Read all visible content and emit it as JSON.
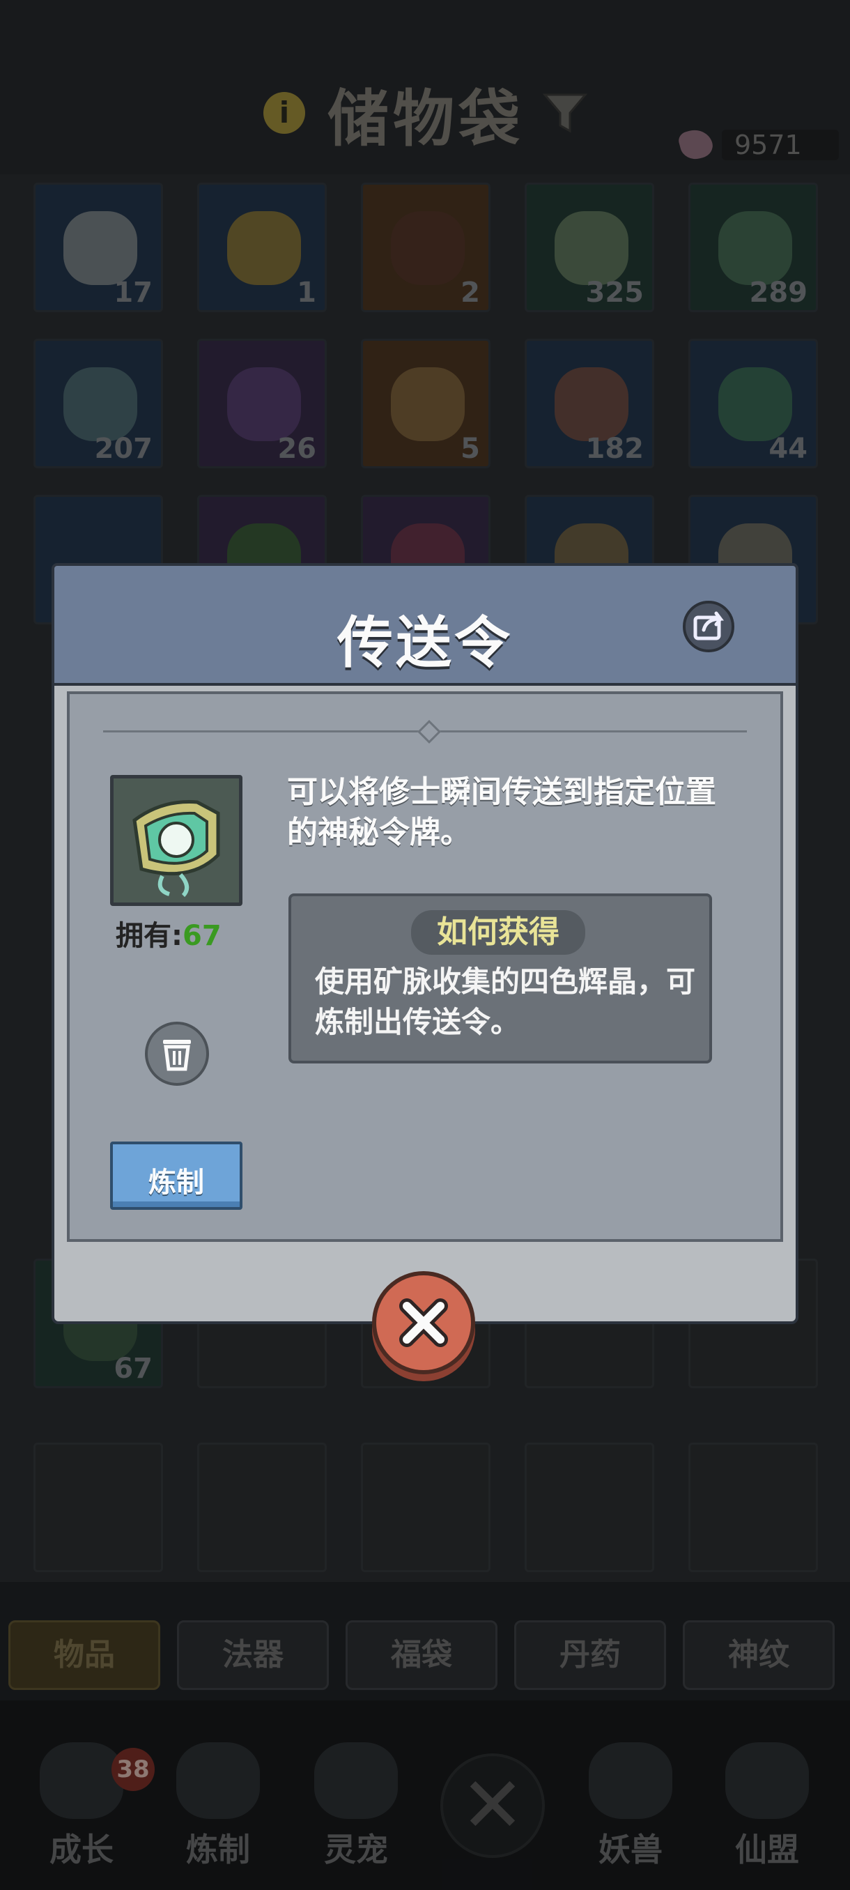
{
  "header": {
    "title": "储物袋",
    "info_icon": "info-icon",
    "filter_icon": "filter-icon",
    "gem_count": "9571"
  },
  "grid": {
    "row1": [
      "17",
      "1",
      "2",
      "325",
      "289"
    ],
    "row2": [
      "207",
      "26",
      "5",
      "182",
      "44"
    ],
    "row7": [
      "67"
    ]
  },
  "tabs": [
    "物品",
    "法器",
    "福袋",
    "丹药",
    "神纹"
  ],
  "nav": {
    "items": [
      "成长",
      "炼制",
      "灵宠",
      "妖兽",
      "仙盟"
    ],
    "badge": "38"
  },
  "dialog": {
    "title": "传送令",
    "share_icon": "share-icon",
    "description": "可以将修士瞬间传送到指定位置的神秘令牌。",
    "own_label": "拥有:",
    "own_count": "67",
    "how_title": "如何获得",
    "how_text": "使用矿脉收集的四色辉晶，可炼制出传送令。",
    "refine_label": "炼制",
    "trash_icon": "trash-icon",
    "close_icon": "close-icon"
  },
  "colors": {
    "dialog_header": "#6d7d97",
    "refine_button": "#6ea4d8",
    "close_button": "#d06a54",
    "how_title_text": "#e9e497",
    "owned_count": "#3a9a21"
  }
}
